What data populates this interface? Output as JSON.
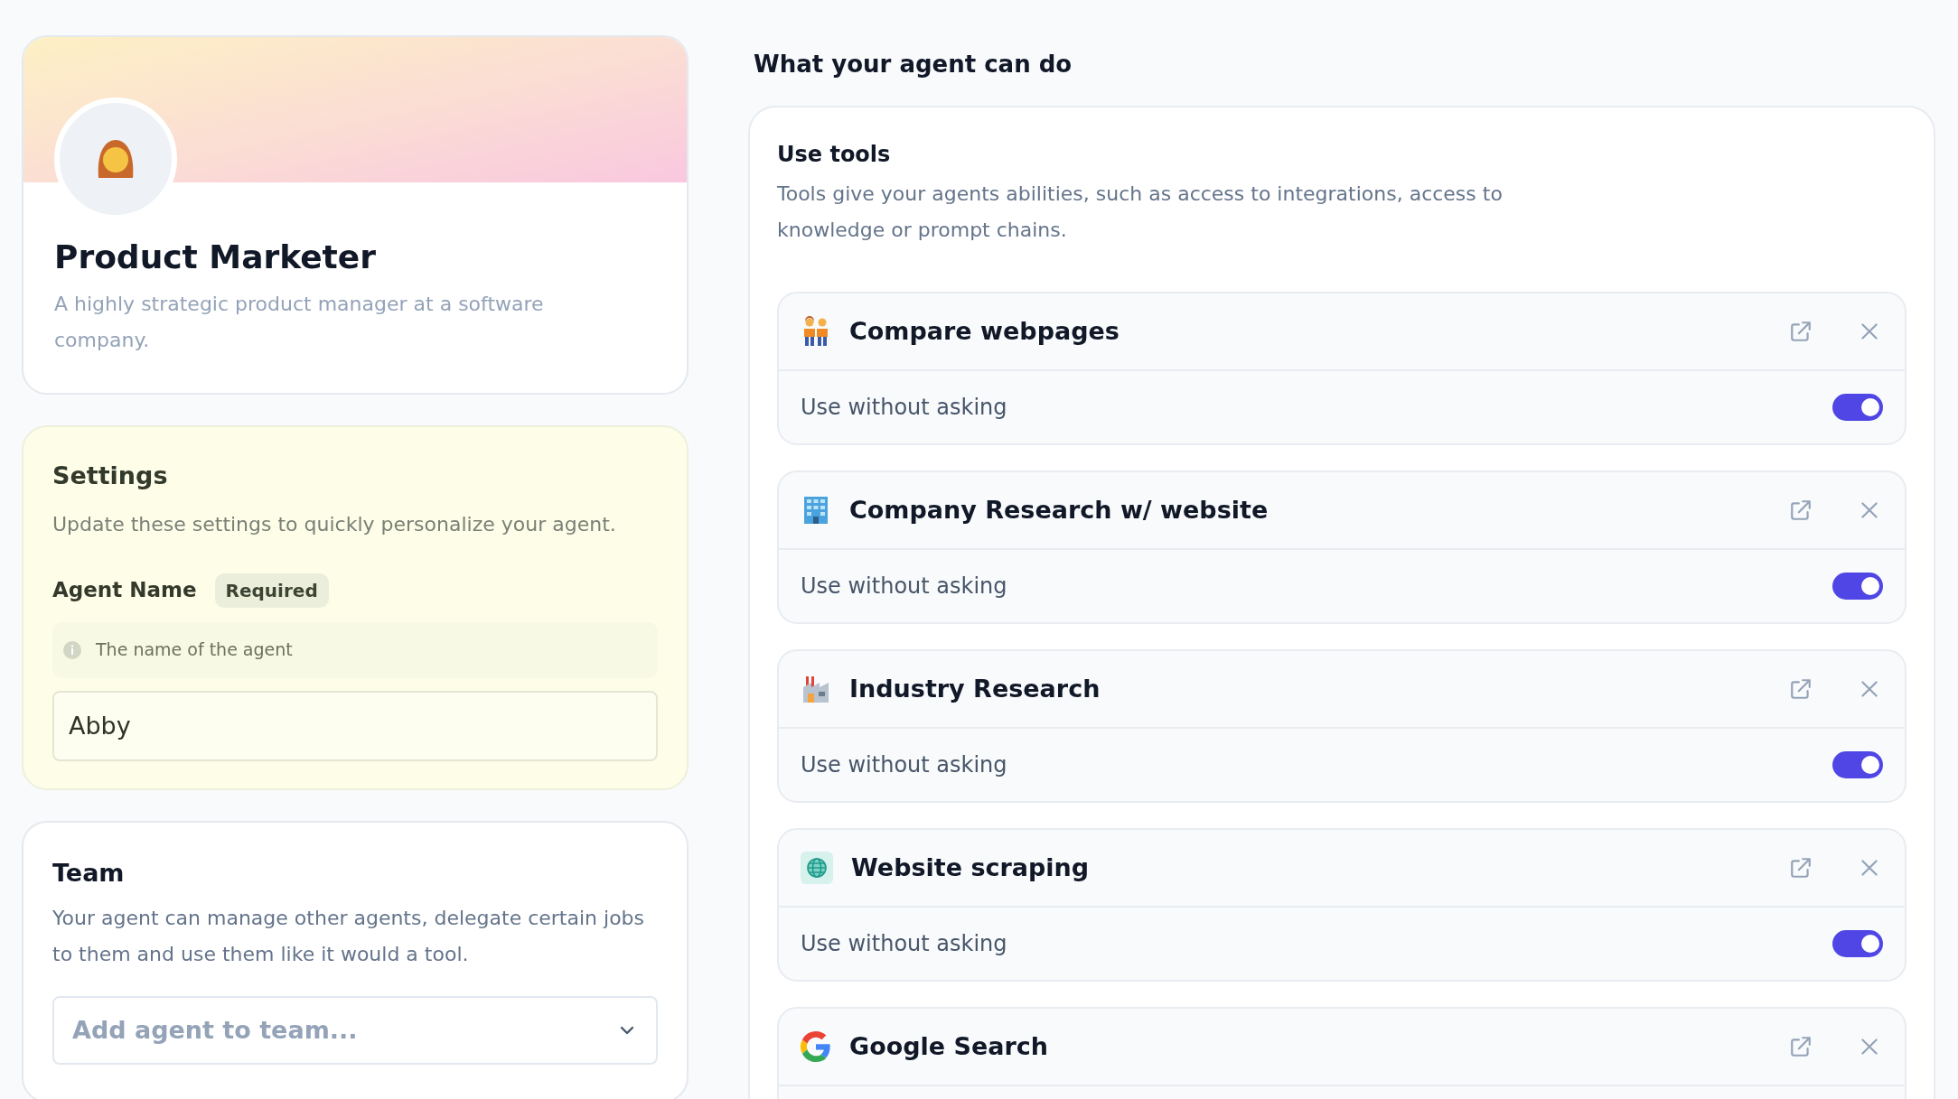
{
  "profile": {
    "name": "Product Marketer",
    "description": "A highly strategic product manager at a software company."
  },
  "settings": {
    "title": "Settings",
    "description": "Update these settings to quickly personalize your agent.",
    "field": {
      "label": "Agent Name",
      "badge": "Required",
      "hint": "The name of the agent",
      "value": "Abby"
    }
  },
  "team": {
    "title": "Team",
    "description": "Your agent can manage other agents, delegate certain jobs to them and use them like it would a tool.",
    "select": {
      "placeholder": "Add agent to team..."
    }
  },
  "capabilities": {
    "heading": "What your agent can do",
    "tools_section": {
      "title": "Use tools",
      "description": "Tools give your agents abilities, such as access to integrations, access to knowledge or prompt chains.",
      "tools": [
        {
          "name": "Compare webpages",
          "option_label": "Use without asking",
          "on": true
        },
        {
          "name": "Company Research w/ website",
          "option_label": "Use without asking",
          "on": true
        },
        {
          "name": "Industry Research",
          "option_label": "Use without asking",
          "on": true
        },
        {
          "name": "Website scraping",
          "option_label": "Use without asking",
          "on": true
        },
        {
          "name": "Google Search"
        }
      ]
    }
  }
}
